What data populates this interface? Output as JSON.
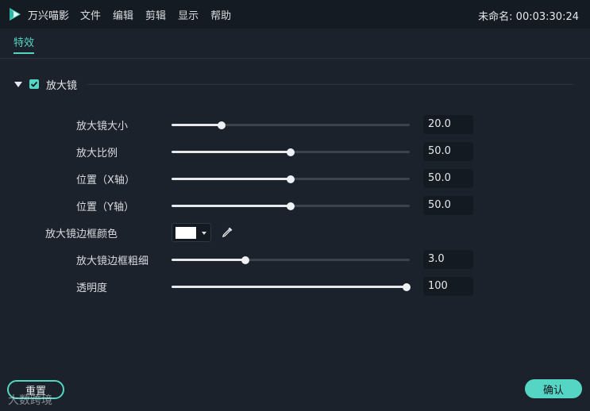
{
  "titlebar": {
    "app_name": "万兴喵影",
    "menu": [
      "文件",
      "编辑",
      "剪辑",
      "显示",
      "帮助"
    ],
    "project_title": "未命名: 00:03:30:24"
  },
  "tabs": [
    {
      "label": "特效",
      "active": true
    }
  ],
  "section": {
    "title": "放大镜",
    "checked": true
  },
  "controls": [
    {
      "label": "放大镜大小",
      "value": "20.0",
      "fraction": 0.21
    },
    {
      "label": "放大比例",
      "value": "50.0",
      "fraction": 0.5
    },
    {
      "label": "位置（X轴）",
      "value": "50.0",
      "fraction": 0.5
    },
    {
      "label": "位置（Y轴）",
      "value": "50.0",
      "fraction": 0.5
    }
  ],
  "border_color": {
    "label": "放大镜边框颜色",
    "color": "#ffffff"
  },
  "controls2": [
    {
      "label": "放大镜边框粗细",
      "value": "3.0",
      "fraction": 0.31
    },
    {
      "label": "透明度",
      "value": "100",
      "fraction": 0.985
    }
  ],
  "buttons": {
    "reset": "重置",
    "ok": "确认"
  },
  "watermark": "大数跨境",
  "colors": {
    "accent": "#55d6c4",
    "background": "#1b222b",
    "titlebar": "#151b22"
  }
}
